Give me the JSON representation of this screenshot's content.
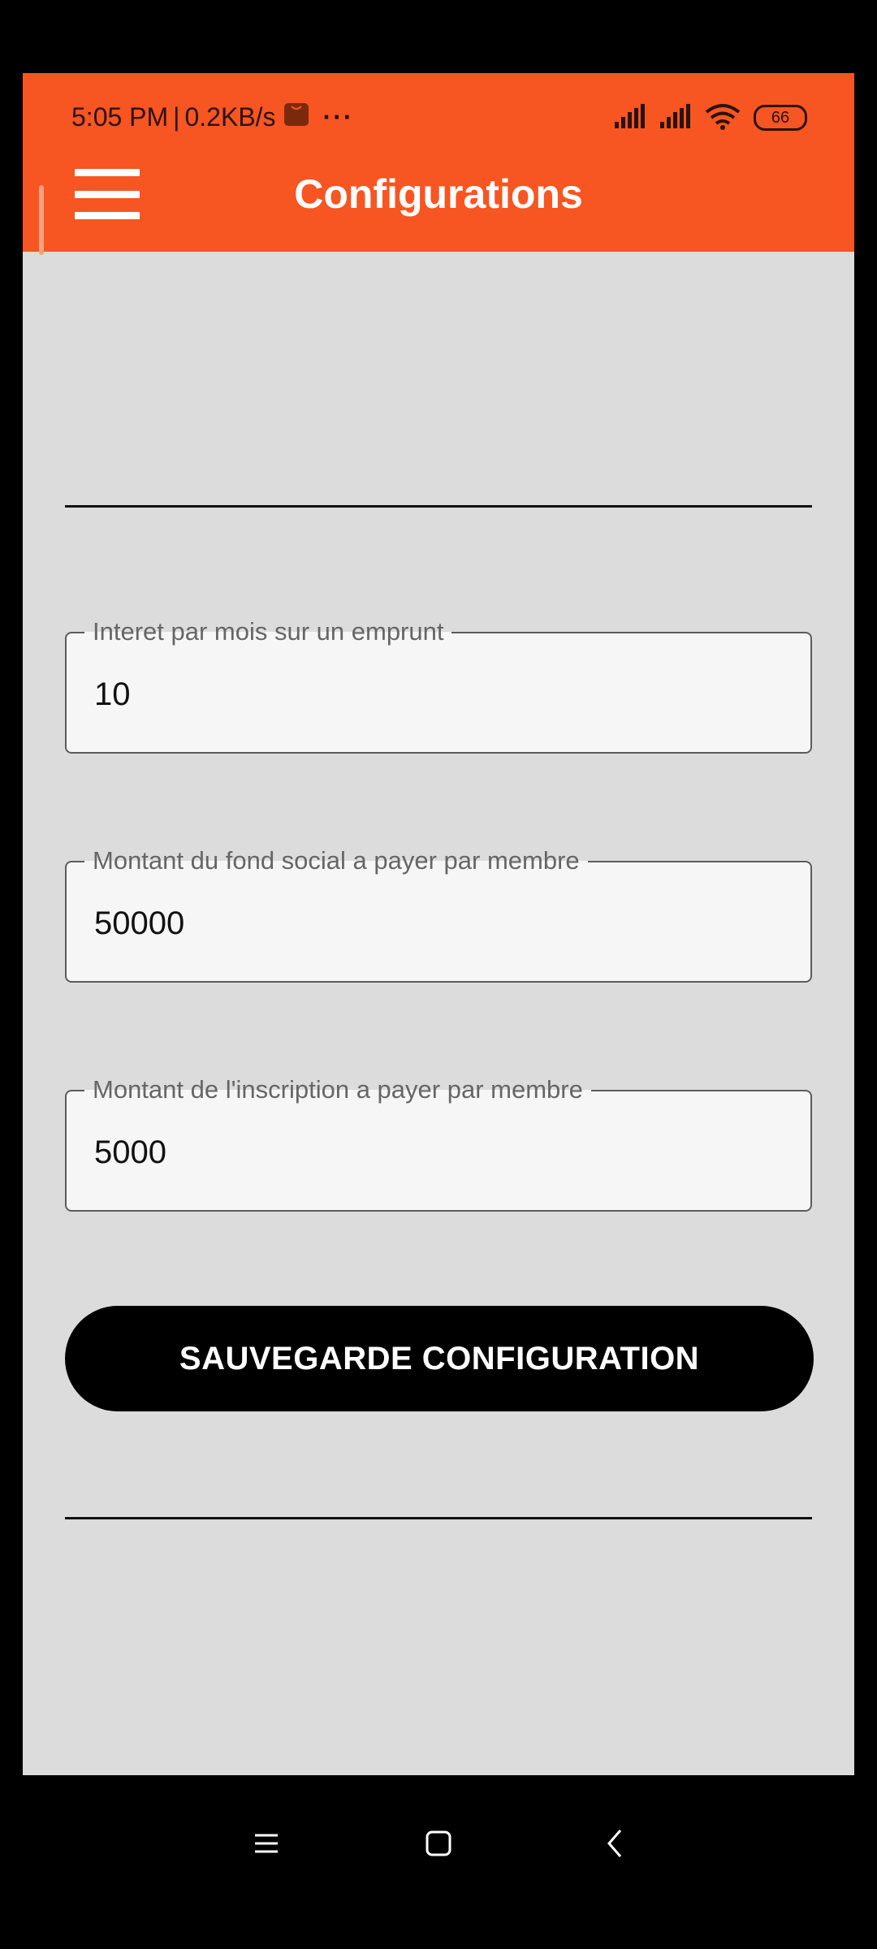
{
  "status_bar": {
    "time": "5:05 PM",
    "separator": "|",
    "net_speed": "0.2KB/s",
    "more_dots": "···",
    "battery_level": "66"
  },
  "app_bar": {
    "title": "Configurations",
    "menu_icon": "hamburger-menu-icon",
    "background_color": "#f75522"
  },
  "form": {
    "fields": [
      {
        "label": "Interet par mois sur un emprunt",
        "value": "10"
      },
      {
        "label": "Montant du fond social a payer par membre",
        "value": "50000"
      },
      {
        "label": "Montant de l'inscription a payer par membre",
        "value": "5000"
      }
    ],
    "save_label": "SAUVEGARDE CONFIGURATION"
  },
  "navigation_bar": {
    "icons": [
      "recents-icon",
      "home-icon",
      "back-icon"
    ]
  }
}
